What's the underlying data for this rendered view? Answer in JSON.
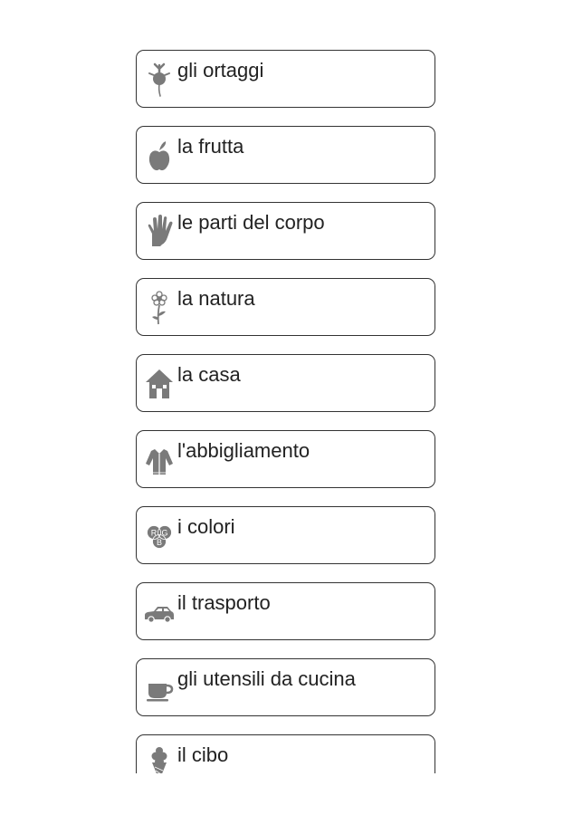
{
  "categories": [
    {
      "label": "gli ortaggi",
      "icon": "beet-icon"
    },
    {
      "label": "la frutta",
      "icon": "apple-icon"
    },
    {
      "label": "le parti del corpo",
      "icon": "hand-icon"
    },
    {
      "label": "la natura",
      "icon": "flower-icon"
    },
    {
      "label": "la casa",
      "icon": "house-icon"
    },
    {
      "label": "l'abbigliamento",
      "icon": "jacket-icon"
    },
    {
      "label": "i colori",
      "icon": "rgb-colors-icon",
      "icon_letters": [
        "R",
        "G",
        "B"
      ]
    },
    {
      "label": "il trasporto",
      "icon": "car-icon"
    },
    {
      "label": "gli utensili da cucina",
      "icon": "cup-icon"
    },
    {
      "label": "il cibo",
      "icon": "ice-cream-icon"
    }
  ],
  "colors": {
    "icon": "#7a7a7a",
    "border": "#333333",
    "text": "#222222",
    "background": "#ffffff"
  }
}
